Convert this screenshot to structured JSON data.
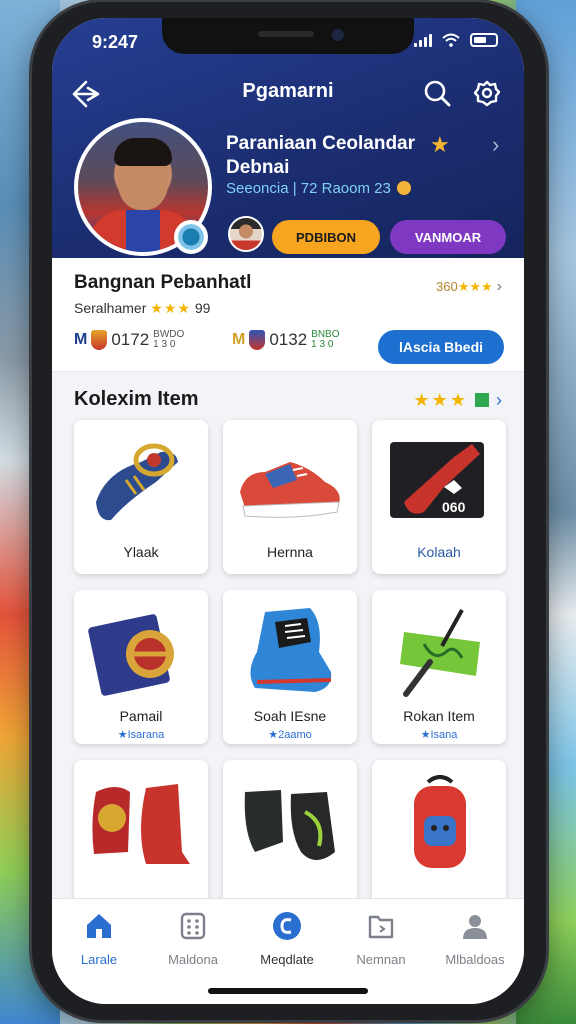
{
  "status": {
    "time": "9:247"
  },
  "topbar": {
    "title": "Pgamarni"
  },
  "profile": {
    "name": "Paraniaan Ceolandar Debnai",
    "stat": "Seeoncia | 72 Raoom 23",
    "btn_primary": "PDBIBON",
    "btn_secondary": "VANMOAR"
  },
  "info": {
    "title": "Bangnan Pebanhatl",
    "sub_prefix": "Seralhamer",
    "sub_stars": "★★★",
    "sub_suffix": "99",
    "rating_text": "360",
    "rating_stars": "★★★",
    "score_a": {
      "team": "M",
      "value": "0172",
      "small_top": "BWDO",
      "small_bottom": "1 3 0"
    },
    "score_b": {
      "team": "M",
      "value": "0132",
      "small_top": "BNBO",
      "small_bottom": "1 3 0"
    },
    "action_button": "lAscia Bbedi"
  },
  "collection": {
    "title": "Kolexim Item",
    "stars": "★★★",
    "items": [
      {
        "label": "Ylaak",
        "sub": ""
      },
      {
        "label": "Hernna",
        "sub": ""
      },
      {
        "label": "Kolaah",
        "sub": ""
      },
      {
        "label": "Pamail",
        "sub": "★Isarana"
      },
      {
        "label": "Soah IEsne",
        "sub": "★2aamo"
      },
      {
        "label": "Rokan Item",
        "sub": "★Isana"
      },
      {
        "label": "",
        "sub": ""
      },
      {
        "label": "",
        "sub": ""
      },
      {
        "label": "",
        "sub": ""
      }
    ]
  },
  "tabs": [
    {
      "label": "Larale",
      "icon": "home-icon"
    },
    {
      "label": "Maldona",
      "icon": "grid-icon"
    },
    {
      "label": "Meqdlate",
      "icon": "badge-icon"
    },
    {
      "label": "Nemnan",
      "icon": "folder-icon"
    },
    {
      "label": "Mlbaldoas",
      "icon": "user-icon"
    }
  ]
}
